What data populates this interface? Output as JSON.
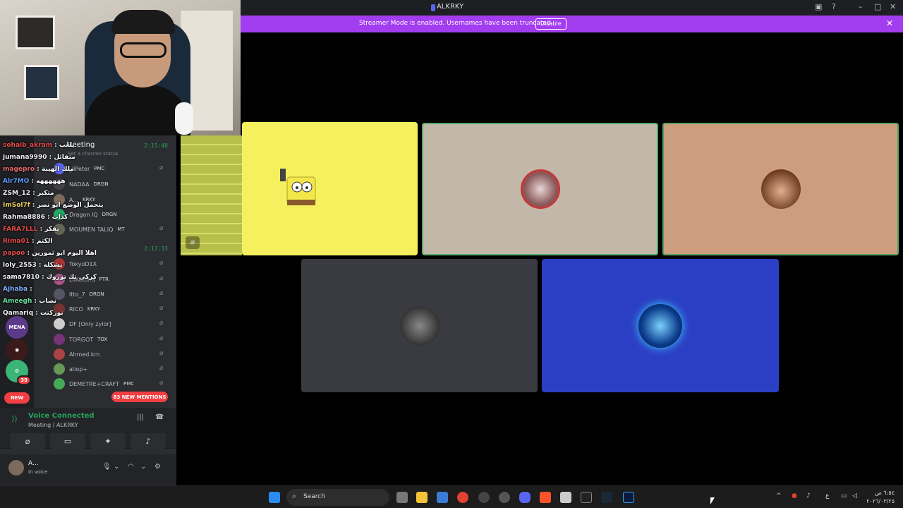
{
  "window": {
    "title": "ALKRKY"
  },
  "banner": {
    "text": "Streamer Mode is enabled. Usernames have been truncated.",
    "button": "Disable"
  },
  "left": {
    "guild_badges": {
      "b1": "39"
    },
    "new_pill": "NEW",
    "channel_name": "Meeting",
    "channel_status": "Set a channel status",
    "timer1": "2:15:48",
    "timer2": "2:17:33",
    "members": [
      {
        "name": "_liPeter",
        "tag": "PMC"
      },
      {
        "name": "NADAA",
        "tag": "DRGN"
      },
      {
        "name": "A...",
        "tag": "KRKY"
      },
      {
        "name": "Dragon IQ",
        "tag": "DRGN"
      },
      {
        "name": "MOUMEN TALIQ",
        "tag": "MT"
      },
      {
        "name": "TokyoD1X",
        "tag": ""
      },
      {
        "name": "LiiKotoha",
        "tag": "PTR"
      },
      {
        "name": "Itto_7",
        "tag": "DRGN"
      },
      {
        "name": "RICO",
        "tag": "KRKY"
      },
      {
        "name": "DF [Only zylor]",
        "tag": ""
      },
      {
        "name": "TORGOT",
        "tag": "TOX"
      },
      {
        "name": "Ahmed.km",
        "tag": ""
      },
      {
        "name": "aliop+",
        "tag": ""
      },
      {
        "name": "DEMETRE+CRAFT",
        "tag": "PMC"
      }
    ],
    "mentions": "83 NEW MENTIONS",
    "chat": [
      {
        "u": "sohaib_akram",
        "m": "يلعب"
      },
      {
        "u": "jumana9990",
        "m": "متفائل"
      },
      {
        "u": "magepro",
        "m": "ملك الهيبة"
      },
      {
        "u": "Alr7MO",
        "m": "ههههههه"
      },
      {
        "u": "ZSM_12",
        "m": "متكبر"
      },
      {
        "u": "ImSol7f",
        "m": "يتحمل الوضع ابو نصر"
      },
      {
        "u": "Rahma8886",
        "m": "كذاب"
      },
      {
        "u": "FARA7LLL",
        "m": "يفكر"
      },
      {
        "u": "Rima01",
        "m": "الكتم"
      },
      {
        "u": "papoo",
        "m": "اهلا اليوم ابو ثمورين"
      },
      {
        "u": "loly_2553",
        "m": "يشكله"
      },
      {
        "u": "sama7810",
        "m": "كركي تك توروك"
      },
      {
        "u": "Ajhaba",
        "m": ""
      },
      {
        "u": "Ameegh",
        "m": "نصاب"
      },
      {
        "u": "Qamariq",
        "m": "نوركتت"
      }
    ],
    "voice": {
      "title": "Voice Connected",
      "sub": "Meeting / ALKRKY"
    },
    "user": {
      "name": "A...",
      "status": "In voice"
    }
  },
  "taskbar": {
    "search": "Search",
    "clock_time": "٦:٥٤ ص",
    "clock_date": "٢٠٢٦/٠٣/٢٥",
    "lang": "ع"
  },
  "colors": {
    "tile_yellow": "#f5f15e",
    "tile_gray": "#c2b7a9",
    "tile_tan": "#cc9d7e",
    "tile_dark": "#393b41",
    "tile_blue": "#2b3fc4",
    "banner": "#a33df0"
  },
  "icons": [
    "windows-icon",
    "search-icon",
    "files-icon",
    "folder-icon",
    "chrome-icon",
    "discord-icon",
    "brave-icon",
    "steam-icon",
    "photoshop-icon",
    "mic-icon",
    "headphones-icon",
    "gear-icon",
    "close-icon"
  ]
}
